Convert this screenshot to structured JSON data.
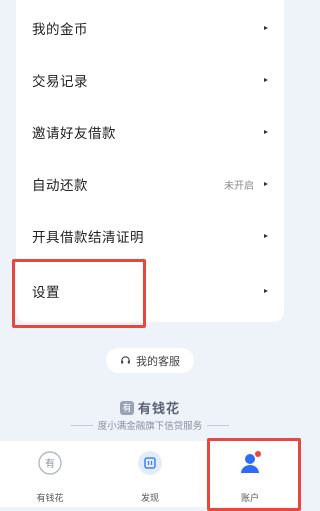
{
  "menu": {
    "items": [
      {
        "label": "我的金币",
        "value": ""
      },
      {
        "label": "交易记录",
        "value": ""
      },
      {
        "label": "邀请好友借款",
        "value": ""
      },
      {
        "label": "自动还款",
        "value": "未开启"
      },
      {
        "label": "开具借款结清证明",
        "value": ""
      },
      {
        "label": "设置",
        "value": ""
      }
    ]
  },
  "service": {
    "label": "我的客服"
  },
  "brand": {
    "logo_text": "有",
    "name": "有钱花",
    "subtitle": "度小满金融旗下信贷服务"
  },
  "tabbar": {
    "tabs": [
      {
        "label": "有钱花",
        "icon": "yqh-logo-icon"
      },
      {
        "label": "发现",
        "icon": "discover-icon"
      },
      {
        "label": "账户",
        "icon": "account-icon"
      }
    ]
  },
  "colors": {
    "highlight": "#e8473e",
    "accent_blue": "#2d6cf6"
  }
}
